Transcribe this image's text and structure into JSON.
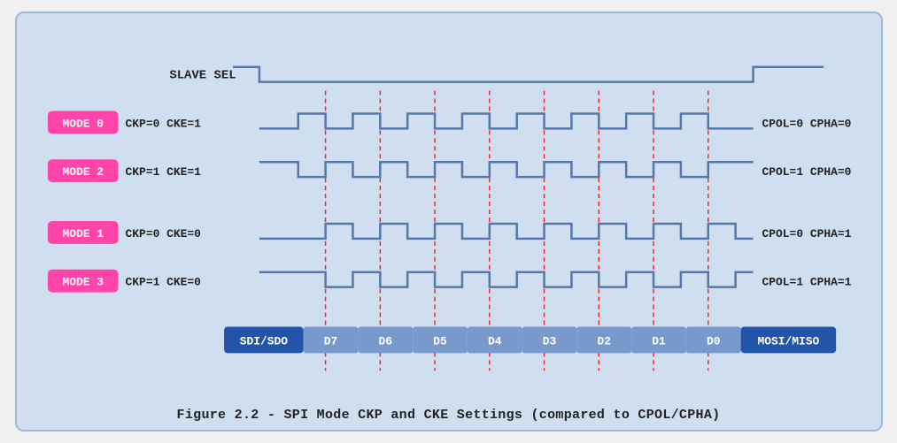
{
  "caption": "Figure 2.2 - SPI Mode CKP and CKE Settings (compared to CPOL/CPHA)",
  "modes": [
    {
      "label": "MODE 0",
      "ckp": "CKP=0",
      "cke": "CKE=1",
      "cpol": "CPOL=0",
      "cpha": "CPHA=0",
      "idle": "low"
    },
    {
      "label": "MODE 2",
      "ckp": "CKP=1",
      "cke": "CKE=1",
      "cpol": "CPOL=1",
      "cpha": "CPHA=0",
      "idle": "high"
    },
    {
      "label": "MODE 1",
      "ckp": "CKP=0",
      "cke": "CKE=0",
      "cpol": "CPOL=0",
      "cpha": "CPHA=1",
      "idle": "low"
    },
    {
      "label": "MODE 3",
      "ckp": "CKP=1",
      "cke": "CKE=0",
      "cpol": "CPOL=1",
      "cpha": "CPHA=1",
      "idle": "high"
    }
  ],
  "data_bits": [
    "D7",
    "D6",
    "D5",
    "D4",
    "D3",
    "D2",
    "D1",
    "D0"
  ],
  "colors": {
    "mode_bg": "#ff44aa",
    "mode_text": "#ffffff",
    "signal": "#5577aa",
    "dashed": "#ff2222",
    "data_bg_dark": "#2255aa",
    "data_bg_light": "#7799cc",
    "data_text": "#ffffff"
  }
}
